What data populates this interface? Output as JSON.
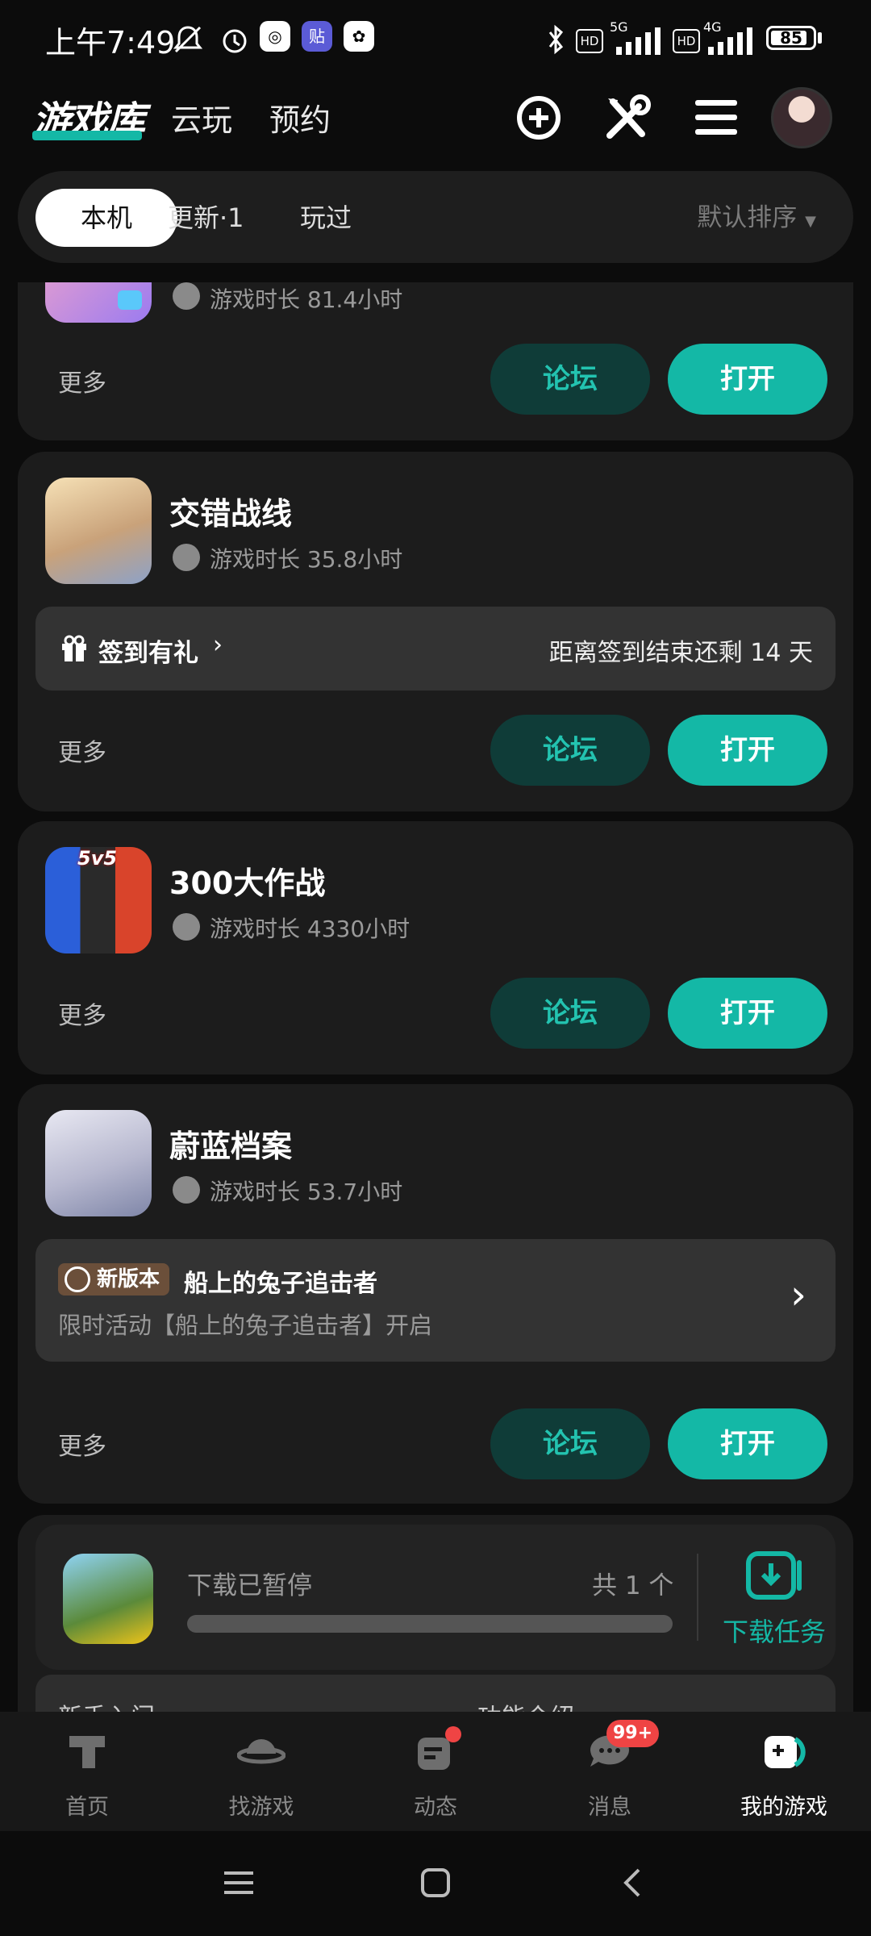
{
  "status_bar": {
    "time": "上午7:49",
    "app_icon_tieba": "贴",
    "battery": "85",
    "net1": "5G",
    "net2": "4G",
    "hd": "HD"
  },
  "header": {
    "tabs": [
      "游戏库",
      "云玩",
      "预约"
    ]
  },
  "filter": {
    "chips": [
      "本机",
      "更新·1",
      "玩过"
    ],
    "sort": "默认排序"
  },
  "cards": [
    {
      "play_time": "游戏时长 81.4小时",
      "more": "更多",
      "forum": "论坛",
      "open": "打开"
    },
    {
      "title": "交错战线",
      "play_time": "游戏时长 35.8小时",
      "signin": "签到有礼",
      "signin_right": "距离签到结束还剩 14 天",
      "more": "更多",
      "forum": "论坛",
      "open": "打开"
    },
    {
      "title": "300大作战",
      "icon_badge": "5v5",
      "play_time": "游戏时长 4330小时",
      "more": "更多",
      "forum": "论坛",
      "open": "打开"
    },
    {
      "title": "蔚蓝档案",
      "play_time": "游戏时长 53.7小时",
      "badge": "新版本",
      "update_title": "船上的兔子追击者",
      "update_desc": "限时活动【船上的兔子追击者】开启",
      "more": "更多",
      "forum": "论坛",
      "open": "打开"
    }
  ],
  "download": {
    "status": "下载已暂停",
    "count": "共 1 个",
    "task_label": "下载任务",
    "progress": 0
  },
  "partial_links": [
    "新手入门",
    "功能介绍"
  ],
  "bottom_nav": [
    {
      "label": "首页",
      "icon": "home-icon"
    },
    {
      "label": "找游戏",
      "icon": "planet-icon"
    },
    {
      "label": "动态",
      "icon": "feed-icon"
    },
    {
      "label": "消息",
      "icon": "message-icon",
      "badge": "99+"
    },
    {
      "label": "我的游戏",
      "icon": "my-games-icon"
    }
  ],
  "colors": {
    "accent": "#14b8a6",
    "forum_bg": "#0f3c38",
    "card_bg": "#1c1c1c",
    "badge_red": "#ef4444"
  }
}
